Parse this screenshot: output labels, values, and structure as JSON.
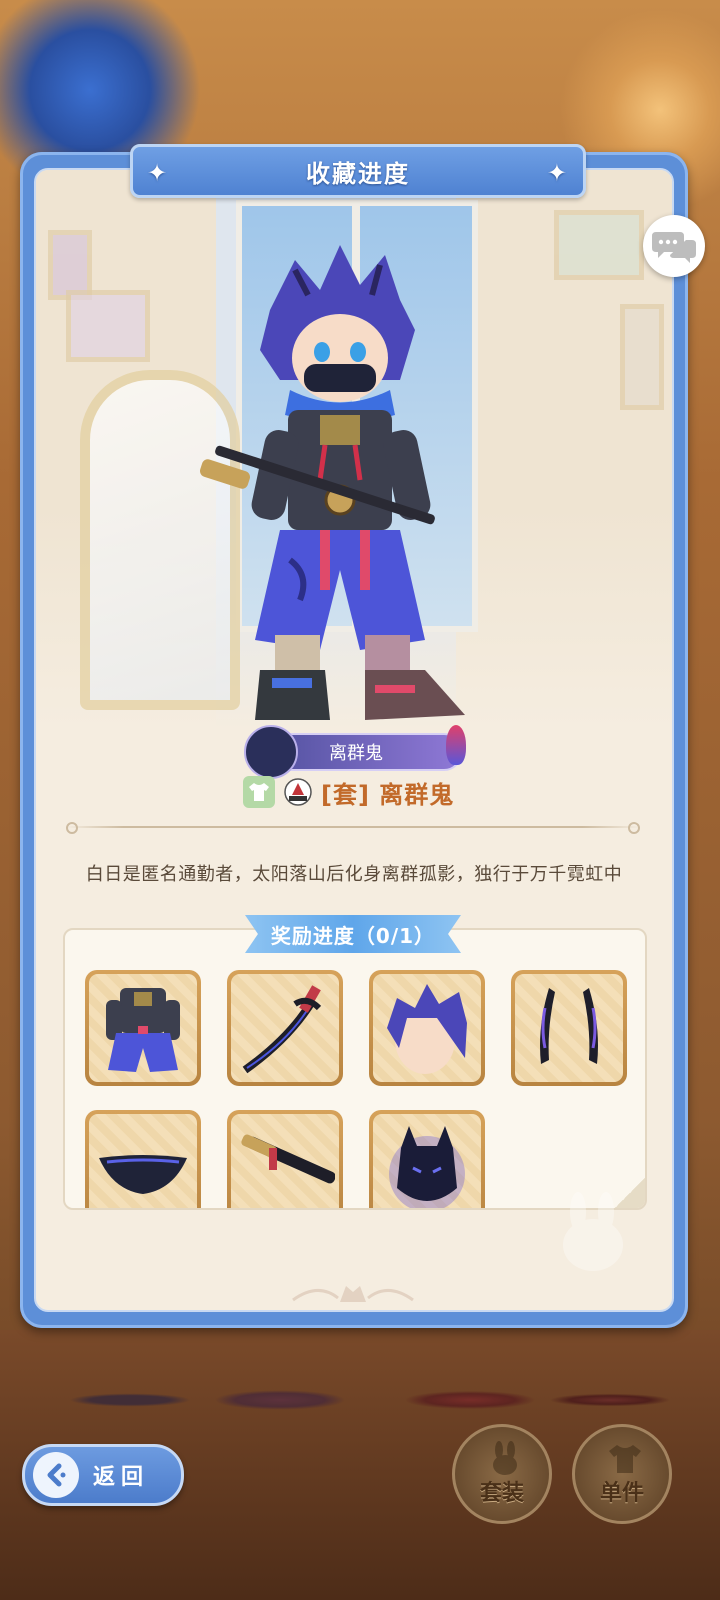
{
  "panel": {
    "title": "收藏进度"
  },
  "character": {
    "name_plate": "离群鬼",
    "set_title": "[套] 离群鬼",
    "description": "白日是匿名通勤者，太阳落山后化身离群孤影，独行于万千霓虹中"
  },
  "reward": {
    "label": "奖励进度（0/1）",
    "items": [
      {
        "icon": "outfit-icon"
      },
      {
        "icon": "katana-icon"
      },
      {
        "icon": "hair-icon"
      },
      {
        "icon": "horns-icon"
      },
      {
        "icon": "mask-icon"
      },
      {
        "icon": "sheathed-sword-icon"
      },
      {
        "icon": "demon-mask-icon"
      }
    ]
  },
  "buttons": {
    "back": "返回",
    "set": "套装",
    "single": "单件"
  },
  "colors": {
    "panel_blue": "#5d8fd8",
    "title_text": "#ffffff",
    "set_title": "#c26a2a",
    "reward_tag": "#5fa6ea",
    "item_frame": "#c8924e"
  }
}
